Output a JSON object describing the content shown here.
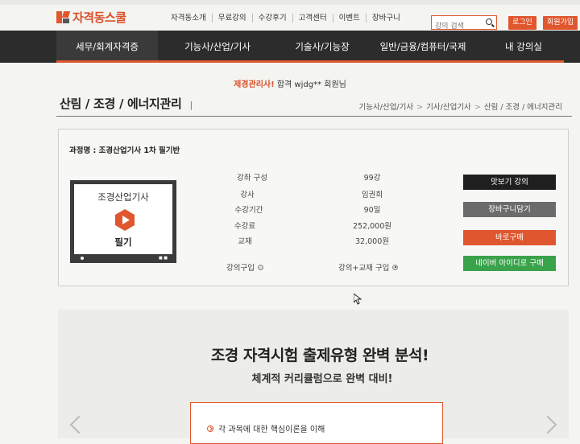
{
  "brand": {
    "name": "자격동스쿨"
  },
  "header": {
    "nav": [
      "자격동소개",
      "무료강의",
      "수강후기",
      "고객센터",
      "이벤트",
      "장바구니"
    ],
    "search_placeholder": "강의 검색",
    "login": "로그인",
    "signup": "회원가입"
  },
  "navbar": {
    "items": [
      "세무/회계자격증",
      "기능사/산업/기사",
      "기술사/기능장",
      "일반/금융/컴퓨터/국제",
      "내 강의실"
    ]
  },
  "ticker": {
    "highlight": "제경관리사!",
    "text": " 합격 wjdg** 회원님"
  },
  "page": {
    "title": "산림 / 조경 / 에너지관리",
    "title_bar": "|",
    "breadcrumb": [
      "기능사/산업/기사",
      "기사/산업기사",
      "산림 / 조경 / 에너지관리"
    ]
  },
  "course": {
    "label": "과정명 : 조경산업기사 1차 필기반",
    "thumb_title": "조경산업기사",
    "thumb_sub": "필기",
    "info": [
      {
        "key": "강좌 구성",
        "value": "99강"
      },
      {
        "key": "강사",
        "value": "임권희"
      },
      {
        "key": "수강기간",
        "value": "90일"
      },
      {
        "key": "수강료",
        "value": "252,000원"
      },
      {
        "key": "교재",
        "value": "32,000원"
      }
    ],
    "options": [
      {
        "label": "강의구입",
        "selected": false
      },
      {
        "label": "강의+교재 구입",
        "selected": true
      }
    ],
    "buttons": {
      "preview": "맛보기 강의",
      "cart": "장바구니담기",
      "buy": "바로구매",
      "naver": "네이버 아이디로 구매"
    }
  },
  "promo": {
    "title": "조경 자격시험 출제유형 완벽 분석!",
    "subtitle": "체계적 커리큘럼으로 완벽 대비!",
    "item": "각 과목에 대한 핵심이론을 이해"
  },
  "colors": {
    "accent": "#e0562e",
    "dark": "#2c2c2c",
    "green": "#3aa24a",
    "gray_btn": "#6b6b6b",
    "black_btn": "#1f1f1f"
  }
}
